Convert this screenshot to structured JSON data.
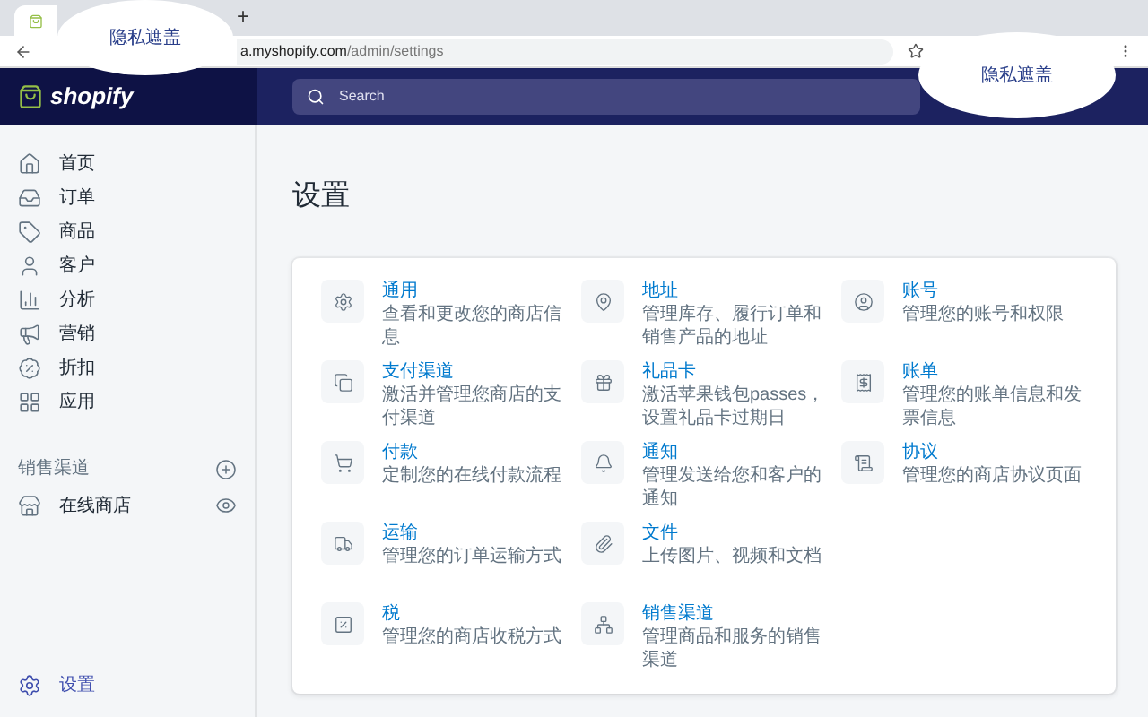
{
  "browser": {
    "new_tab": "+",
    "url_host": "a.myshopify.com",
    "url_path": "/admin/settings",
    "privacy_masks": [
      "隐私遮盖",
      "隐私遮盖"
    ]
  },
  "topbar": {
    "logo": "shopify",
    "search": {
      "placeholder": "Search"
    }
  },
  "sidebar": {
    "items": [
      {
        "label": "首页",
        "selected": false
      },
      {
        "label": "订单",
        "selected": false
      },
      {
        "label": "商品",
        "selected": false
      },
      {
        "label": "客户",
        "selected": false
      },
      {
        "label": "分析",
        "selected": false
      },
      {
        "label": "营销",
        "selected": false
      },
      {
        "label": "折扣",
        "selected": false
      },
      {
        "label": "应用",
        "selected": false
      }
    ],
    "section": {
      "title": "销售渠道",
      "channels": [
        {
          "label": "在线商店"
        }
      ]
    },
    "bottom": {
      "label": "设置",
      "selected": true
    }
  },
  "page": {
    "title": "设置",
    "columns": [
      [
        {
          "title": "通用",
          "description": "查看和更改您的商店信息"
        },
        {
          "title": "支付渠道",
          "description": "激活并管理您商店的支付渠道"
        },
        {
          "title": "付款",
          "description": "定制您的在线付款流程"
        },
        {
          "title": "运输",
          "description": "管理您的订单运输方式"
        },
        {
          "title": "税",
          "description": "管理您的商店收税方式"
        }
      ],
      [
        {
          "title": "地址",
          "description": "管理库存、履行订单和销售产品的地址"
        },
        {
          "title": "礼品卡",
          "description": "激活苹果钱包passes，设置礼品卡过期日"
        },
        {
          "title": "通知",
          "description": "管理发送给您和客户的通知"
        },
        {
          "title": "文件",
          "description": "上传图片、视频和文档"
        },
        {
          "title": "销售渠道",
          "description": "管理商品和服务的销售渠道"
        }
      ],
      [
        {
          "title": "账号",
          "description": "管理您的账号和权限"
        },
        {
          "title": "账单",
          "description": "管理您的账单信息和发票信息"
        },
        {
          "title": "协议",
          "description": "管理您的商店协议页面"
        }
      ]
    ]
  }
}
